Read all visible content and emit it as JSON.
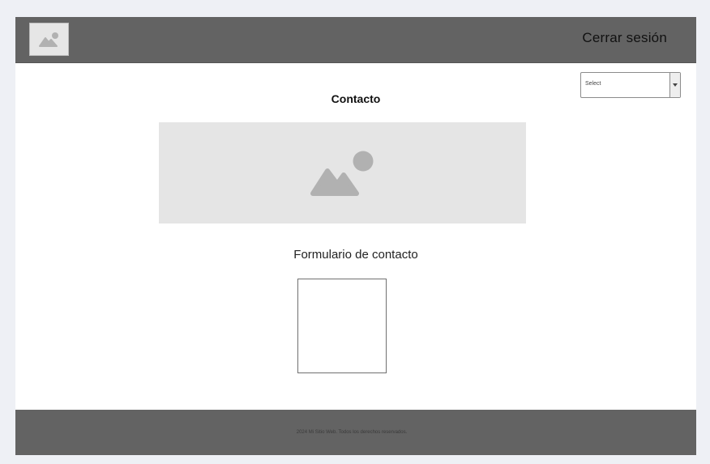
{
  "header": {
    "logout_label": "Cerrar sesión"
  },
  "select": {
    "value": "Select"
  },
  "main": {
    "title": "Contacto",
    "form_title": "Formulario de contacto"
  },
  "footer": {
    "text": "2024 Mi Sitio Web. Todos los derechos reservados."
  },
  "icons": {
    "logo": "image-placeholder-icon",
    "hero": "image-placeholder-icon",
    "select_arrow": "chevron-down-icon"
  },
  "colors": {
    "header_bg": "#636363",
    "footer_bg": "#636363",
    "placeholder_bg": "#e5e5e5",
    "placeholder_icon": "#b1b1b1",
    "page_bg": "#eef0f5"
  }
}
